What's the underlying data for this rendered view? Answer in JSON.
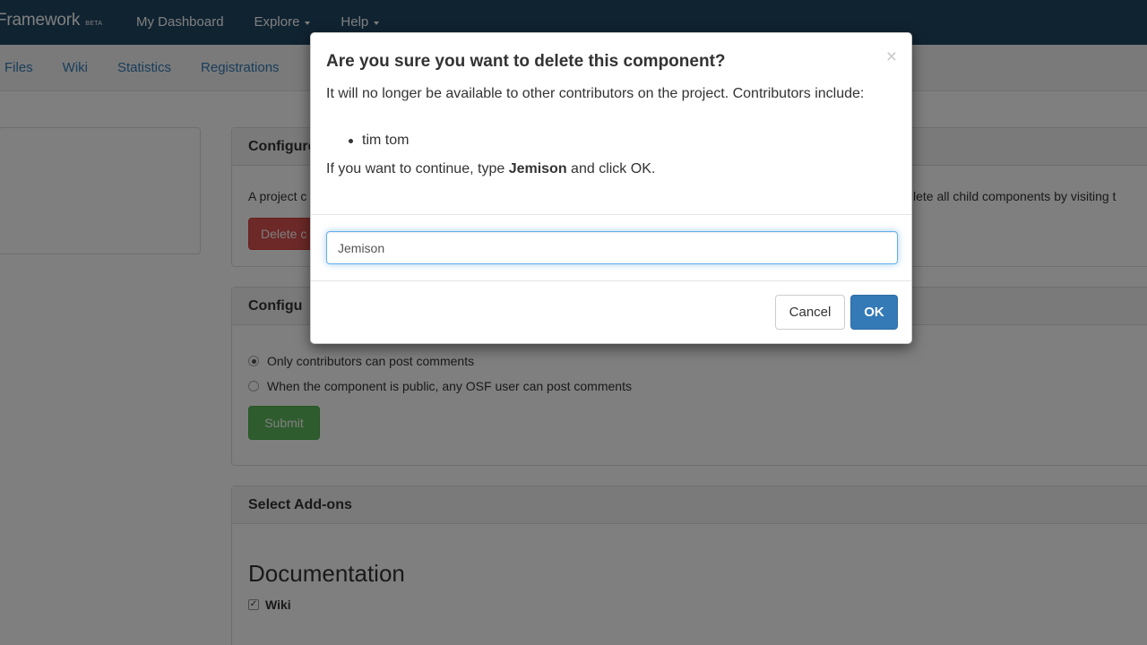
{
  "navbar": {
    "brand": "Framework",
    "brand_badge": "BETA",
    "links": [
      {
        "label": "My Dashboard",
        "dropdown": false
      },
      {
        "label": "Explore",
        "dropdown": true
      },
      {
        "label": "Help",
        "dropdown": true
      }
    ]
  },
  "subnav": {
    "links": [
      "Files",
      "Wiki",
      "Statistics",
      "Registrations"
    ]
  },
  "panels": {
    "delete": {
      "heading": "Configure",
      "text_left": "A project c",
      "text_right": "lete all child components by visiting t",
      "button_label": "Delete c"
    },
    "comments": {
      "heading": "Configu",
      "option_1": "Only contributors can post comments",
      "option_2": "When the component is public, any OSF user can post comments",
      "submit_label": "Submit"
    },
    "addons": {
      "heading": "Select Add-ons",
      "section_title": "Documentation",
      "checkbox_label": "Wiki",
      "checkbox_checked": true
    }
  },
  "modal": {
    "title": "Are you sure you want to delete this component?",
    "close_glyph": "×",
    "message": "It will no longer be available to other contributors on the project. Contributors include:",
    "contributors": [
      "tim tom"
    ],
    "instruction_prefix": "If you want to continue, type ",
    "instruction_name": "Jemison",
    "instruction_suffix": " and click OK.",
    "input_value": "Jemison",
    "cancel_label": "Cancel",
    "ok_label": "OK"
  },
  "colors": {
    "navbar": "#214762",
    "primary": "#337ab7",
    "danger": "#d9534f",
    "success": "#5cb85c"
  }
}
